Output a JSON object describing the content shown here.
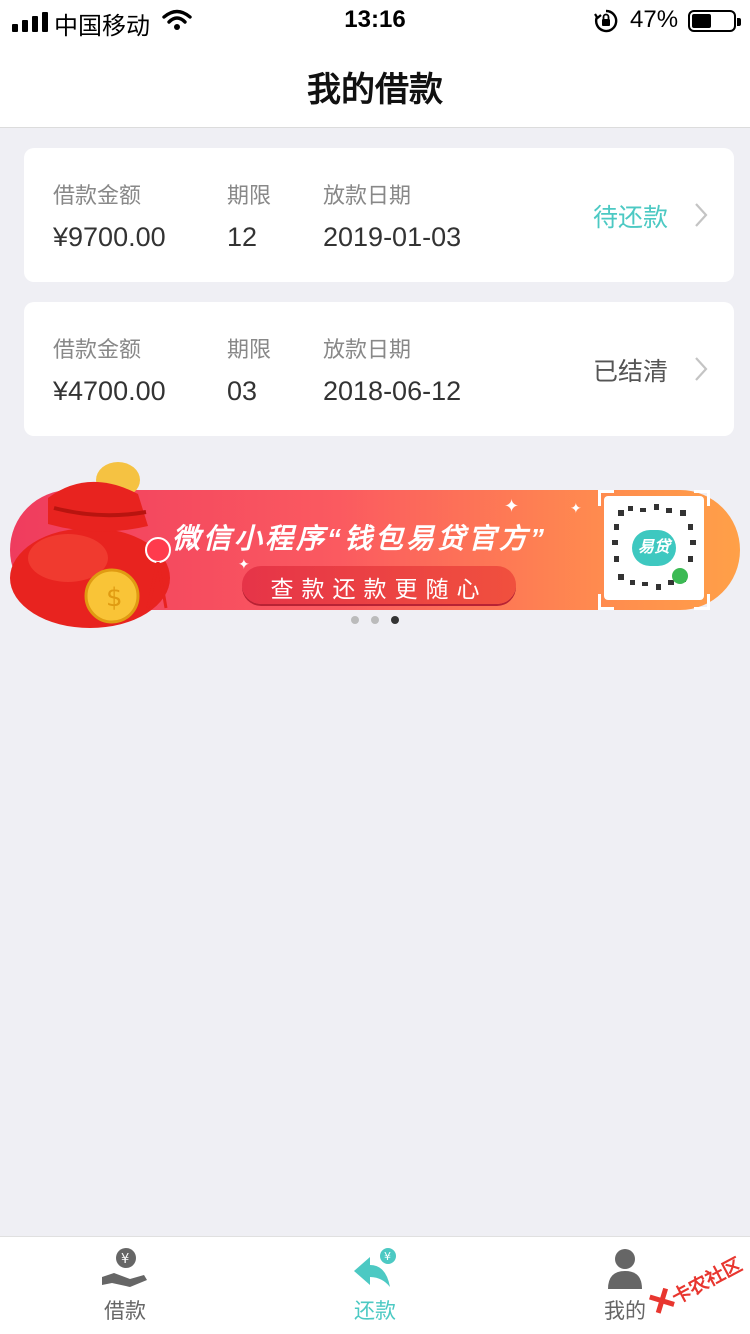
{
  "status_bar": {
    "carrier": "中国移动",
    "time": "13:16",
    "battery_percent": "47%",
    "battery_level": 0.47
  },
  "header": {
    "title": "我的借款"
  },
  "loans": [
    {
      "amount_label": "借款金额",
      "amount": "¥9700.00",
      "term_label": "期限",
      "term": "12",
      "date_label": "放款日期",
      "date": "2019-01-03",
      "status": "待还款",
      "status_color": "#4cc9c3"
    },
    {
      "amount_label": "借款金额",
      "amount": "¥4700.00",
      "term_label": "期限",
      "term": "03",
      "date_label": "放款日期",
      "date": "2018-06-12",
      "status": "已结清",
      "status_color": "#555555"
    }
  ],
  "banner": {
    "title": "微信小程序“钱包易贷官方”",
    "subtitle": "查款还款更随心",
    "qr_badge": "易贷",
    "page_count": 3,
    "active_page": 3
  },
  "tab_bar": {
    "accent_color": "#4cc9c3",
    "inactive_color": "#666666",
    "items": [
      {
        "label": "借款",
        "icon": "hand-yuan-icon",
        "active": false
      },
      {
        "label": "还款",
        "icon": "return-arrow-yuan-icon",
        "active": true
      },
      {
        "label": "我的",
        "icon": "user-icon",
        "active": false
      }
    ]
  },
  "watermark": {
    "text": "卡农社区"
  }
}
